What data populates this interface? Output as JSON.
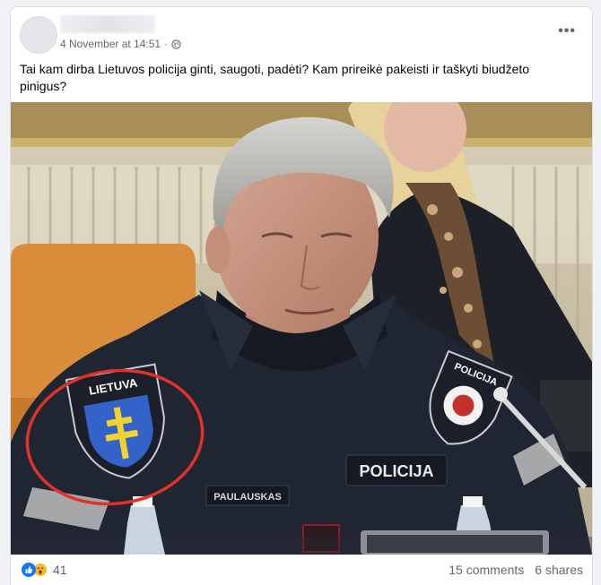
{
  "post": {
    "timestamp": "4 November at 14:51",
    "separator": "·",
    "privacy_icon": "globe-icon",
    "more_icon": "more-options-icon",
    "more_label": "•••",
    "caption": "Tai kam dirba Lietuvos policija ginti, saugoti, padėti? Kam prireikė pakeisti ir taškyti biudžeto pinigus?"
  },
  "photo": {
    "shoulder_patch": "LIETUVA",
    "chest_patch": "POLICIJA",
    "right_shoulder_patch": "POLICIJA",
    "name_tag": "PAULAUSKAS",
    "annotation_color": "#e0312b"
  },
  "footer": {
    "reaction_icons": [
      "like-icon",
      "wow-icon"
    ],
    "reaction_count": "41",
    "comments": "15 comments",
    "shares": "6 shares"
  },
  "colors": {
    "link_blue": "#1877f2",
    "meta_gray": "#65676b",
    "uniform": "#1f2632"
  }
}
